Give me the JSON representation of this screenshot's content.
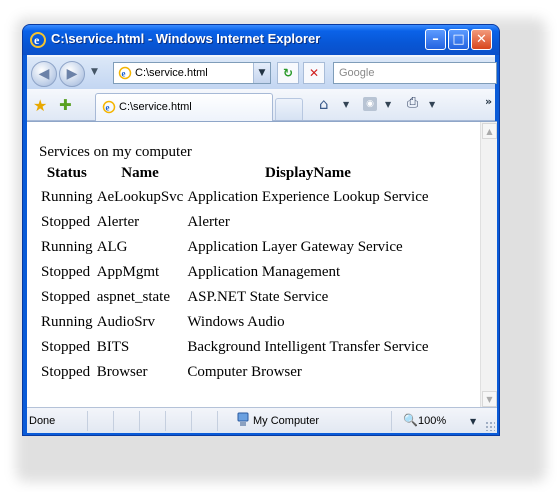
{
  "window": {
    "title": "C:\\service.html - Windows Internet Explorer",
    "minimize_glyph": "–",
    "maximize_glyph": "□",
    "close_glyph": "✕"
  },
  "nav": {
    "back_glyph": "◀",
    "forward_glyph": "▶",
    "history_glyph": "▼",
    "address": "C:\\service.html",
    "address_drop_glyph": "▼",
    "refresh_glyph": "↻",
    "stop_glyph": "✕",
    "search_placeholder": "Google"
  },
  "favorites_bar": {
    "star_glyph": "★",
    "add_glyph": "✚",
    "tab_label": "C:\\service.html",
    "home_glyph": "⌂",
    "feed_glyph": "◉",
    "print_glyph": "⎙",
    "dropdown_glyph": "▼",
    "more_glyph": "»"
  },
  "page": {
    "heading": "Services on my computer",
    "columns": [
      "Status",
      "Name",
      "DisplayName"
    ],
    "rows": [
      [
        "Running",
        "AeLookupSvc",
        "Application Experience Lookup Service"
      ],
      [
        "Stopped",
        "Alerter",
        "Alerter"
      ],
      [
        "Running",
        "ALG",
        "Application Layer Gateway Service"
      ],
      [
        "Stopped",
        "AppMgmt",
        "Application Management"
      ],
      [
        "Stopped",
        "aspnet_state",
        "ASP.NET State Service"
      ],
      [
        "Running",
        "AudioSrv",
        "Windows Audio"
      ],
      [
        "Stopped",
        "BITS",
        "Background Intelligent Transfer Service"
      ],
      [
        "Stopped",
        "Browser",
        "Computer Browser"
      ]
    ]
  },
  "scrollbar": {
    "up_glyph": "▲",
    "down_glyph": "▼"
  },
  "statusbar": {
    "status": "Done",
    "zone": "My Computer",
    "zoom_glyph": "🔍",
    "zoom": "100%",
    "zoom_drop_glyph": "▼"
  },
  "colors": {
    "titlebar": "#0a5bd8",
    "chrome": "#dce8f8",
    "close_button": "#d8461c"
  },
  "icons": [
    "ie-logo-icon",
    "back-arrow-icon",
    "forward-arrow-icon",
    "page-icon",
    "refresh-icon",
    "stop-icon",
    "favorites-star-icon",
    "add-favorites-icon",
    "home-icon",
    "feeds-icon",
    "print-icon",
    "computer-zone-icon",
    "zoom-icon"
  ]
}
